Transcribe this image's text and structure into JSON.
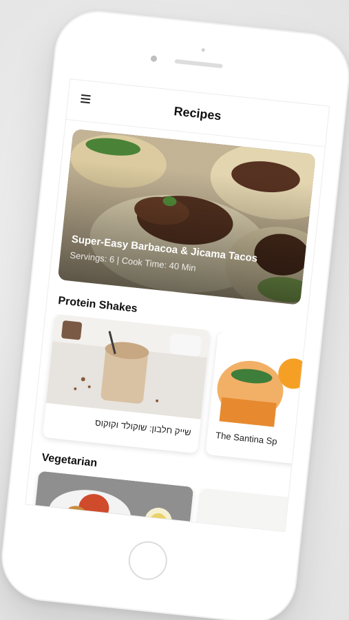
{
  "app": {
    "title": "Recipes"
  },
  "featured": {
    "title": "Super-Easy Barbacoa & Jicama Tacos",
    "meta": "Servings: 6 | Cook Time: 40 Min"
  },
  "sections": [
    {
      "title": "Protein Shakes",
      "cards": [
        {
          "label": "שייק חלבון: שוקולד וקוקוס",
          "direction": "rtl"
        },
        {
          "label": "The Santina Sp",
          "direction": "ltr"
        }
      ]
    },
    {
      "title": "Vegetarian",
      "cards": []
    }
  ],
  "icons": {
    "menu": "hamburger-menu-icon"
  }
}
